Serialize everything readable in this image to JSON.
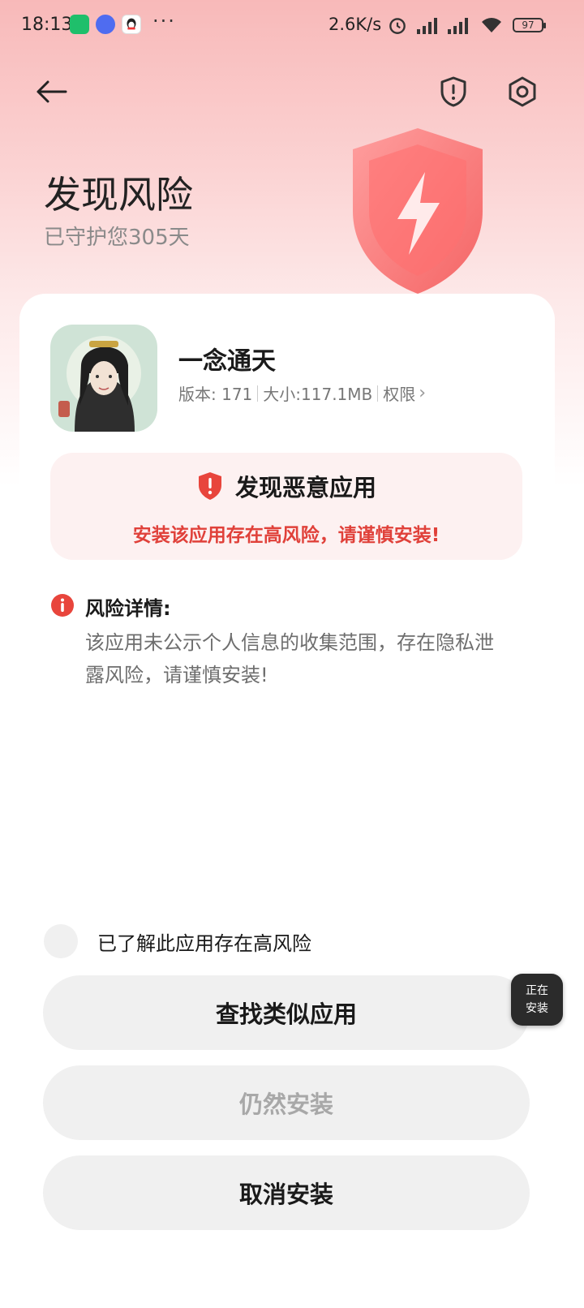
{
  "status_bar": {
    "time": "18:13",
    "dots": "···",
    "net_speed": "2.6K/s",
    "battery": "97"
  },
  "header": {
    "title": "发现风险",
    "subtitle": "已守护您305天"
  },
  "app": {
    "name": "一念通天",
    "version": "版本: 171",
    "size": "大小:117.1MB",
    "permissions": "权限",
    "permissions_chevron": "›"
  },
  "warning": {
    "title": "发现恶意应用",
    "message": "安装该应用存在高风险，请谨慎安装!"
  },
  "risk": {
    "label": "风险详情:",
    "detail": "该应用未公示个人信息的收集范围，存在隐私泄露风险，请谨慎安装!"
  },
  "acknowledge": {
    "label": "已了解此应用存在高风险"
  },
  "buttons": {
    "find_similar": "查找类似应用",
    "install_anyway": "仍然安装",
    "cancel": "取消安装"
  },
  "floating": {
    "line1": "正在",
    "line2": "安装"
  },
  "colors": {
    "accent_red": "#e0413a",
    "header_bg": "#f8b9b9",
    "button_bg": "#f0f0f0"
  }
}
